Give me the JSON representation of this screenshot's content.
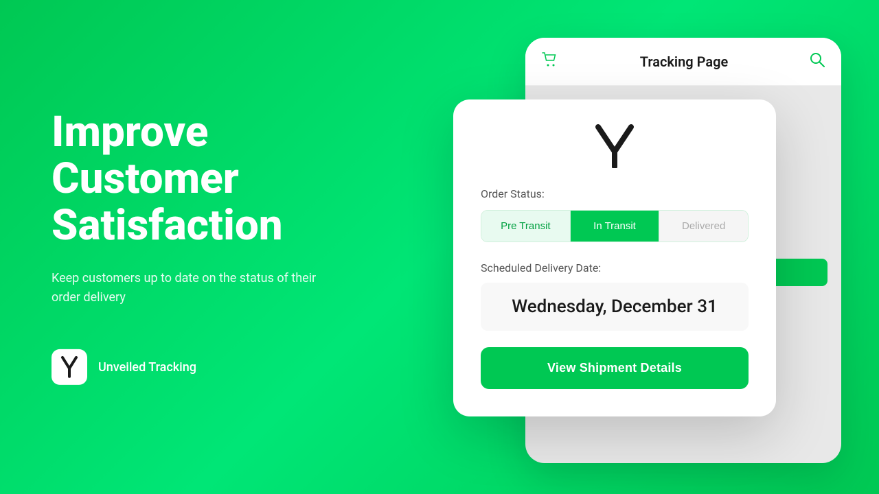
{
  "background": {
    "gradient_start": "#00c853",
    "gradient_end": "#00e676"
  },
  "left": {
    "headline_line1": "Improve",
    "headline_line2": "Customer",
    "headline_line3": "Satisfaction",
    "subtext": "Keep customers up to date on the status of their order delivery",
    "brand_label": "Unveiled Tracking"
  },
  "phone_bg": {
    "title": "Tracking Page",
    "cart_icon": "🛒",
    "search_icon": "🔍"
  },
  "card": {
    "logo_text": "Y/",
    "order_status_label": "Order Status:",
    "tabs": [
      {
        "id": "pre-transit",
        "label": "Pre Transit",
        "state": "active-light"
      },
      {
        "id": "in-transit",
        "label": "In Transit",
        "state": "active-dark"
      },
      {
        "id": "delivered",
        "label": "Delivered",
        "state": "inactive"
      }
    ],
    "delivery_date_label": "Scheduled Delivery Date:",
    "delivery_date": "Wednesday, December 31",
    "cta_button": "View Shipment Details"
  }
}
